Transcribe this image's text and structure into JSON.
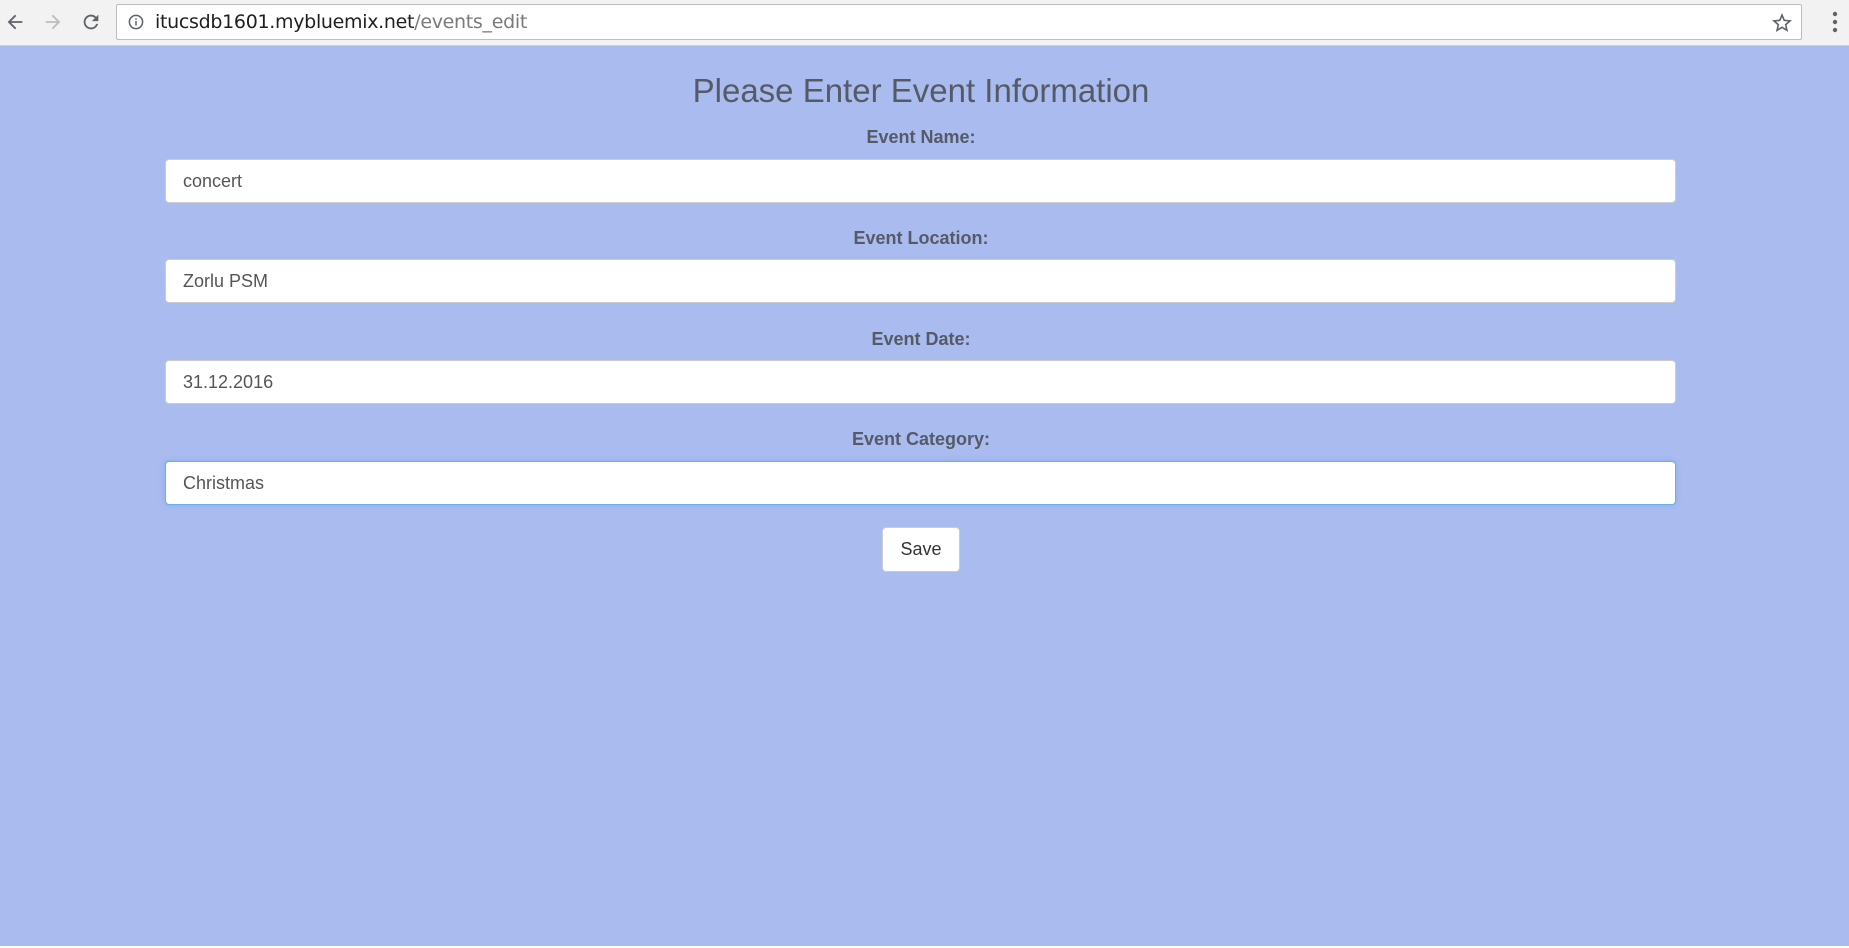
{
  "browser": {
    "url_host": "itucsdb1601.mybluemix.net",
    "url_path": "/events_edit",
    "icons": [
      "back-arrow-icon",
      "forward-arrow-icon",
      "reload-icon",
      "site-info-icon",
      "bookmark-star-icon",
      "kebab-menu-icon"
    ]
  },
  "page": {
    "title": "Please Enter Event Information",
    "background_color": "#aabbf0"
  },
  "form": {
    "fields": [
      {
        "label": "Event Name:",
        "value": "concert"
      },
      {
        "label": "Event Location:",
        "value": "Zorlu PSM"
      },
      {
        "label": "Event Date:",
        "value": "31.12.2016"
      },
      {
        "label": "Event Category:",
        "value": "Christmas"
      }
    ],
    "save_label": "Save"
  }
}
